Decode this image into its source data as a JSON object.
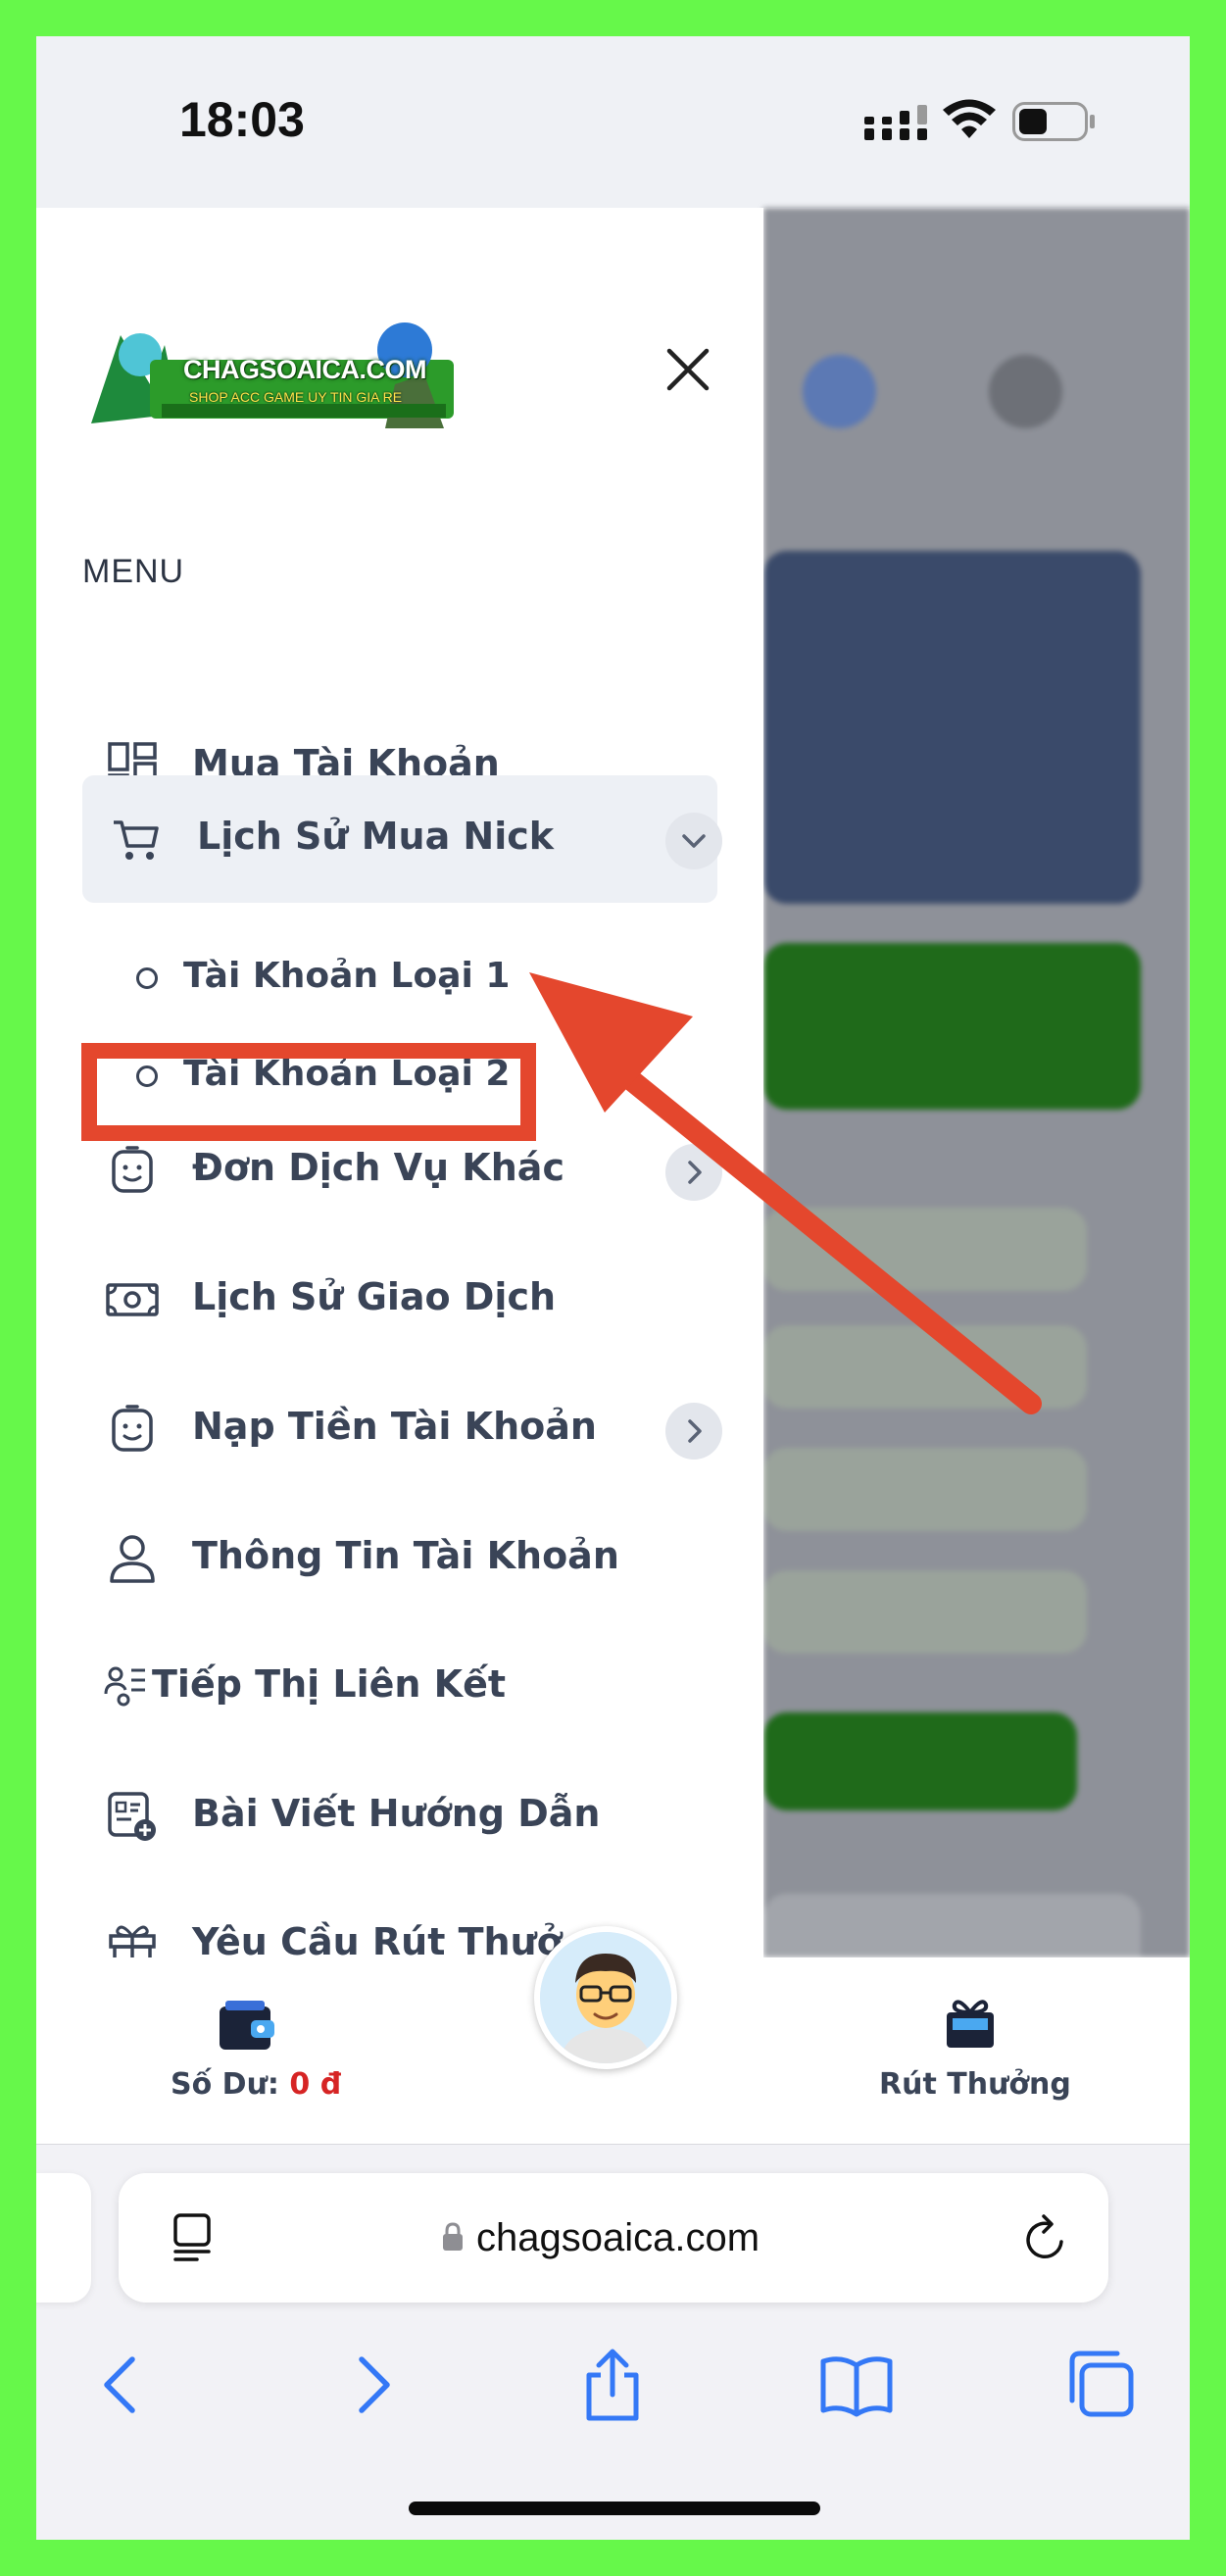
{
  "status_bar": {
    "time": "18:03"
  },
  "logo": {
    "title": "CHAGSOAICA.COM",
    "subtitle": "SHOP ACC GAME UY TIN GIA RE"
  },
  "menu": {
    "title": "MENU",
    "items": [
      {
        "label": "Mua Tài Khoản",
        "icon": "dashboard-icon"
      },
      {
        "label": "Lịch Sử Mua Nick",
        "icon": "cart-icon",
        "expanded": true,
        "children": [
          {
            "label": "Tài Khoản Loại 1"
          },
          {
            "label": "Tài Khoản Loại 2"
          }
        ]
      },
      {
        "label": "Đơn Dịch Vụ Khác",
        "icon": "face-icon",
        "has_submenu": true
      },
      {
        "label": "Lịch Sử Giao Dịch",
        "icon": "money-icon"
      },
      {
        "label": "Nạp Tiền Tài Khoản",
        "icon": "face-icon",
        "has_submenu": true
      },
      {
        "label": "Thông Tin Tài Khoản",
        "icon": "user-icon"
      },
      {
        "label": "Tiếp Thị Liên Kết",
        "icon": "affiliate-icon"
      },
      {
        "label": "Bài Viết Hướng Dẫn",
        "icon": "article-add-icon"
      },
      {
        "label": "Yêu Cầu Rút Thưở",
        "icon": "gift-icon"
      }
    ]
  },
  "bottom_bar": {
    "balance_label": "Số Dư:",
    "balance_value": "0 đ",
    "reward_label": "Rút Thưởng"
  },
  "browser": {
    "domain": "chagsoaica.com"
  },
  "colors": {
    "accent_green": "#66f84a",
    "highlight_red": "#e4472d",
    "text": "#3a4457",
    "ios_blue": "#3478f6"
  }
}
